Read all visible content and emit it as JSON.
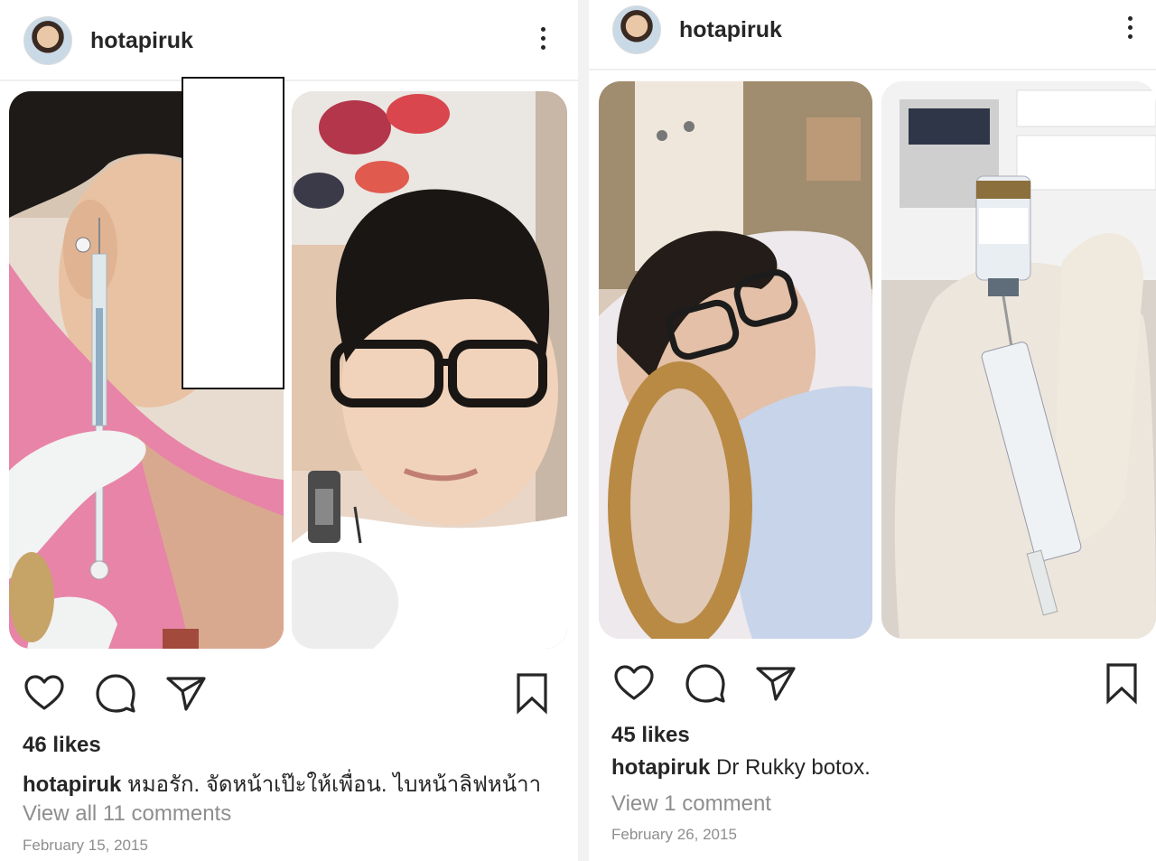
{
  "posts": [
    {
      "username": "hotapiruk",
      "likes": "46 likes",
      "caption_user": "hotapiruk",
      "caption_text": "หมอรัก. จัดหน้าเป๊ะให้เพื่อน. ไบหน้าลิฟหน้าา",
      "comments_link": "View all 11 comments",
      "date": "February 15, 2015"
    },
    {
      "username": "hotapiruk",
      "likes": "45 likes",
      "caption_user": "hotapiruk",
      "caption_text": "Dr Rukky botox.",
      "comments_link": "View 1 comment",
      "date": "February 26, 2015"
    }
  ],
  "icons": [
    "more-options-icon",
    "heart-icon",
    "comment-icon",
    "share-icon",
    "bookmark-icon"
  ],
  "colors": {
    "text": "#262626",
    "secondary": "#8e8e8e",
    "divider": "#efefef"
  }
}
